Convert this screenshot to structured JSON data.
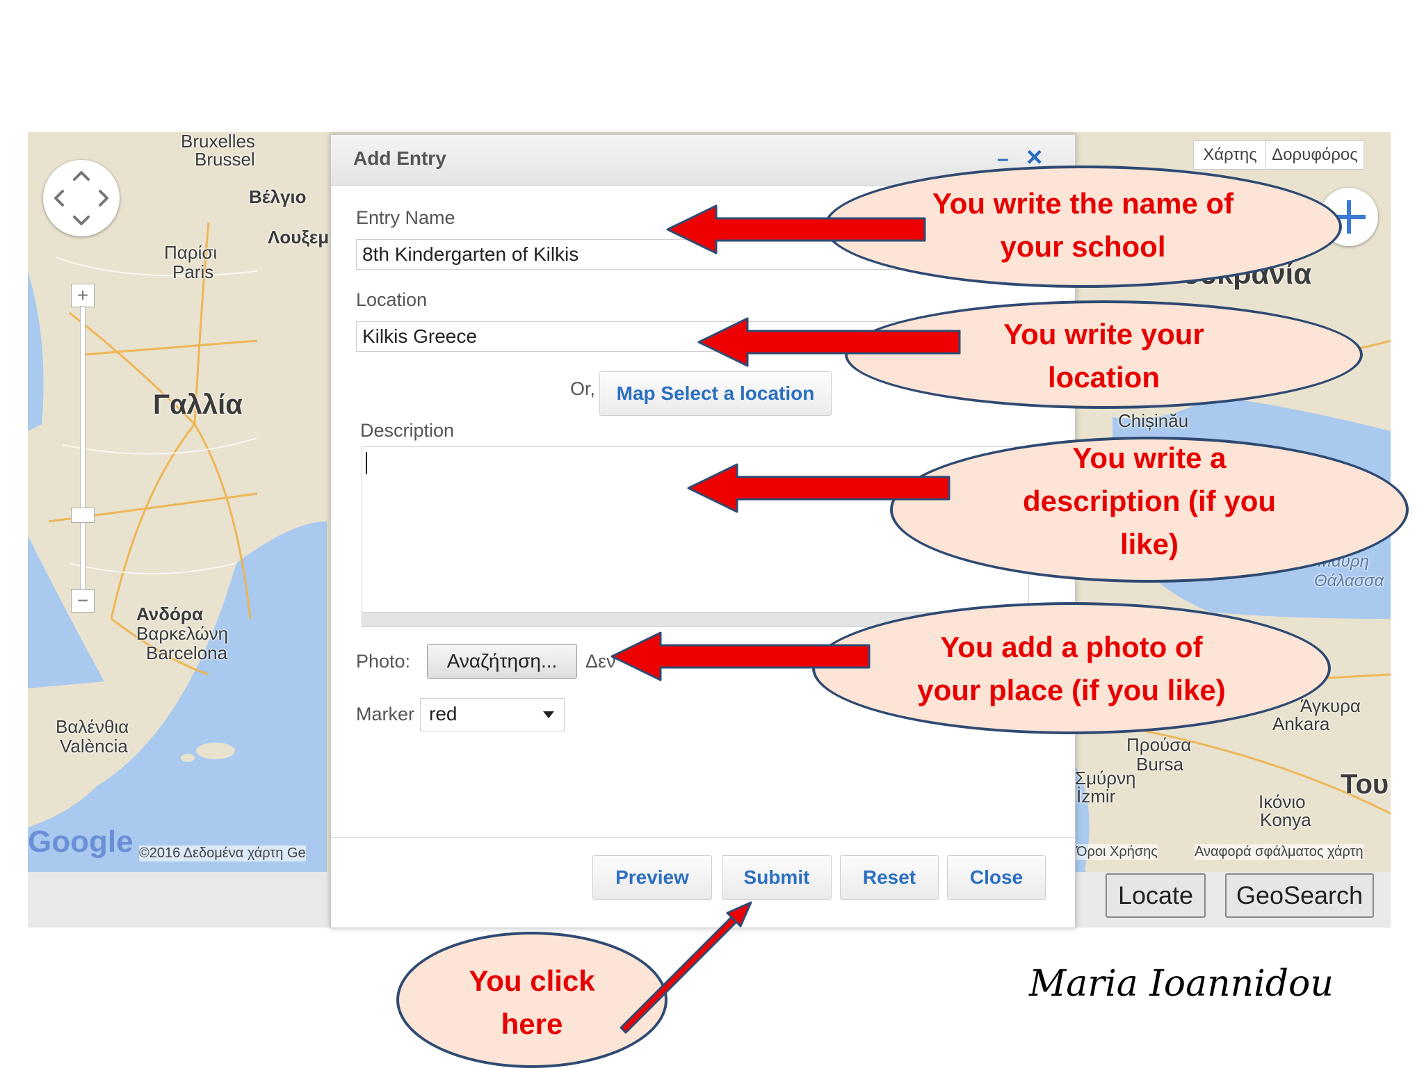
{
  "map": {
    "labels": {
      "bruxelles": "Bruxelles",
      "brussel": "Brussel",
      "belgio": "Βέλγιο",
      "louxemvourgo": "Λουξεμ",
      "parisi": "Παρίσι",
      "paris": "Paris",
      "gallia": "Γαλλία",
      "andorra": "Ανδόρα",
      "varkelona": "Βαρκελώνη",
      "barcelona": "Barcelona",
      "valentia": "Βαλένθια",
      "valencia": "València",
      "ukraine": "ουκρανία",
      "chisinau": "Chișinău",
      "mavri": "Μαύρη",
      "thalassa": "Θάλασσα",
      "ankara_gr": "Άγκυρα",
      "ankara": "Ankara",
      "prousa": "Προύσα",
      "bursa": "Bursa",
      "smyrni": "Σμύρνη",
      "izmir": "İzmir",
      "tou": "Του",
      "ikonio": "Ικόνιο",
      "konya": "Konya"
    },
    "type_tabs": [
      "Χάρτης",
      "Δορυφόρος"
    ],
    "google_logo": "Google",
    "copyright": "©2016 Δεδομένα χάρτη Ge",
    "terms": "Όροι Χρήσης",
    "report": "Αναφορά σφάλματος χάρτη",
    "zoom_in": "+",
    "zoom_out": "−"
  },
  "footer_buttons": {
    "locate": "Locate",
    "geosearch": "GeoSearch"
  },
  "dialog": {
    "title": "Add Entry",
    "minimize": "–",
    "close_x": "×",
    "entry_name_label": "Entry Name",
    "entry_name_value": "8th Kindergarten of Kilkis",
    "location_label": "Location",
    "location_value": "Kilkis Greece",
    "or_text": "Or,",
    "map_select_label": "Map Select a location",
    "description_label": "Description",
    "description_value": "",
    "photo_label": "Photo:",
    "browse_label": "Αναζήτηση...",
    "no_file_text": "Δεν",
    "marker_label": "Marker",
    "marker_value": "red",
    "buttons": {
      "preview": "Preview",
      "submit": "Submit",
      "reset": "Reset",
      "close": "Close"
    }
  },
  "callouts": {
    "name": [
      "You write the name of",
      "your school"
    ],
    "location": [
      "You write your",
      "location"
    ],
    "description": [
      "You write a",
      "description (if you",
      "like)"
    ],
    "photo": [
      "You add a photo of",
      "your place (if you like)"
    ],
    "submit": [
      "You click",
      "here"
    ]
  },
  "signature": "Maria Ioannidou",
  "colors": {
    "arrow_fill": "#ee0000",
    "arrow_stroke": "#2f4a72",
    "callout_fill": "#fce4d6",
    "callout_text": "#e60000",
    "button_text": "#2a6fc1"
  }
}
